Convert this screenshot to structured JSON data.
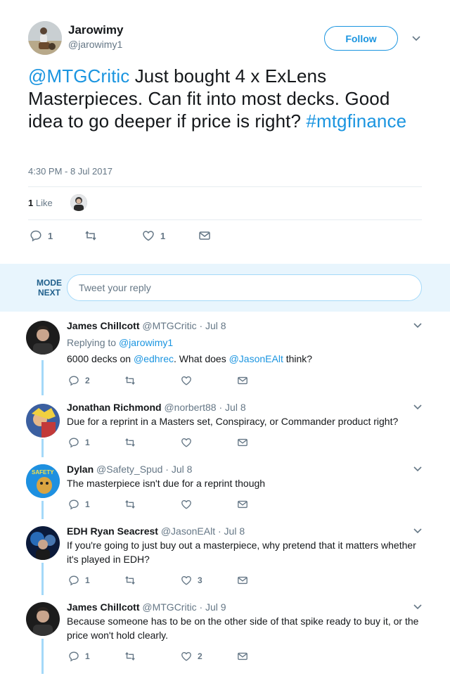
{
  "main_tweet": {
    "author_name": "Jarowimy",
    "author_handle": "@jarowimy1",
    "follow_label": "Follow",
    "text_mention": "@MTGCritic",
    "text_body": " Just bought 4 x ExLens Masterpieces. Can fit into most decks. Good idea to go deeper if price is right? ",
    "text_hashtag": "#mtgfinance",
    "timestamp": "4:30 PM - 8 Jul 2017",
    "likes_number": "1",
    "likes_word": "Like",
    "actions": {
      "reply_count": "1",
      "retweet_count": "",
      "like_count": "1"
    }
  },
  "reply_box": {
    "placeholder": "Tweet your reply",
    "avatar_text": "MODE NEXT"
  },
  "replies": [
    {
      "name": "James Chillcott",
      "handle": "@MTGCritic",
      "date": "· Jul 8",
      "replying_prefix": "Replying to ",
      "replying_handle": "@jarowimy1",
      "text_parts": [
        "6000 decks on ",
        "@edhrec",
        ". What does ",
        "@JasonEAlt",
        " think?"
      ],
      "reply_count": "2",
      "like_count": ""
    },
    {
      "name": "Jonathan Richmond",
      "handle": "@norbert88",
      "date": "· Jul 8",
      "text": "Due for a reprint in a Masters set, Conspiracy, or Commander product right?",
      "reply_count": "1",
      "like_count": ""
    },
    {
      "name": "Dylan",
      "handle": "@Safety_Spud",
      "date": "· Jul 8",
      "text": "The masterpiece isn't due for a reprint though",
      "reply_count": "1",
      "like_count": "",
      "avatar_text": "SAFETY SPUD"
    },
    {
      "name": "EDH Ryan Seacrest",
      "handle": "@JasonEAlt",
      "date": "· Jul 8",
      "text": "If you're going to just buy out a masterpiece, why pretend that it matters whether it's played in EDH?",
      "reply_count": "1",
      "like_count": "3"
    },
    {
      "name": "James Chillcott",
      "handle": "@MTGCritic",
      "date": "· Jul 9",
      "text": "Because someone has to be on the other side of that spike ready to buy it, or the price won't hold clearly.",
      "reply_count": "1",
      "like_count": "2"
    }
  ],
  "colors": {
    "link": "#1b95e0",
    "muted": "#657786",
    "reply_bar": "#e8f5fd",
    "thread_line": "#a4d9f9"
  }
}
